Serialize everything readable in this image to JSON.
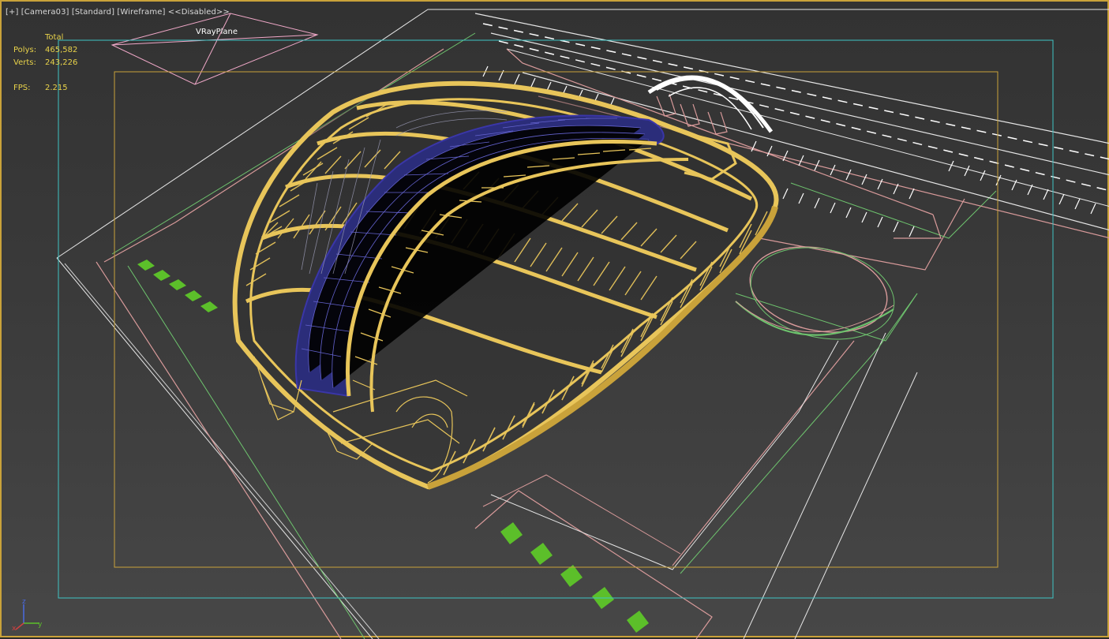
{
  "viewport": {
    "menu_plus": "[+]",
    "camera": "[Camera03]",
    "shading_standard": "[Standard]",
    "shading_mode": "[Wireframe]",
    "disabled": "<<Disabled>>"
  },
  "stats": {
    "total_label": "Total",
    "polys_label": "Polys:",
    "polys_value": "465,582",
    "verts_label": "Verts:",
    "verts_value": "243,226",
    "fps_label": "FPS:",
    "fps_value": "2.215"
  },
  "scene": {
    "vray_plane_label": "VRayPlane"
  },
  "axis_gizmo": {
    "z": "z",
    "y": "y",
    "x": "x"
  },
  "colors": {
    "frame_border": "#c9a23a",
    "safe_frame_outer": "#3fc4c4",
    "safe_frame_inner": "#c9a23a",
    "stats_text": "#e8d24a",
    "structure": "#e8c55a",
    "glass_roof": "#3a36a8",
    "site_lines": "#d89a9a",
    "green_lines": "#6ec46e",
    "green_blocks": "#5cbf2a",
    "parking_lines": "#ffffff"
  }
}
